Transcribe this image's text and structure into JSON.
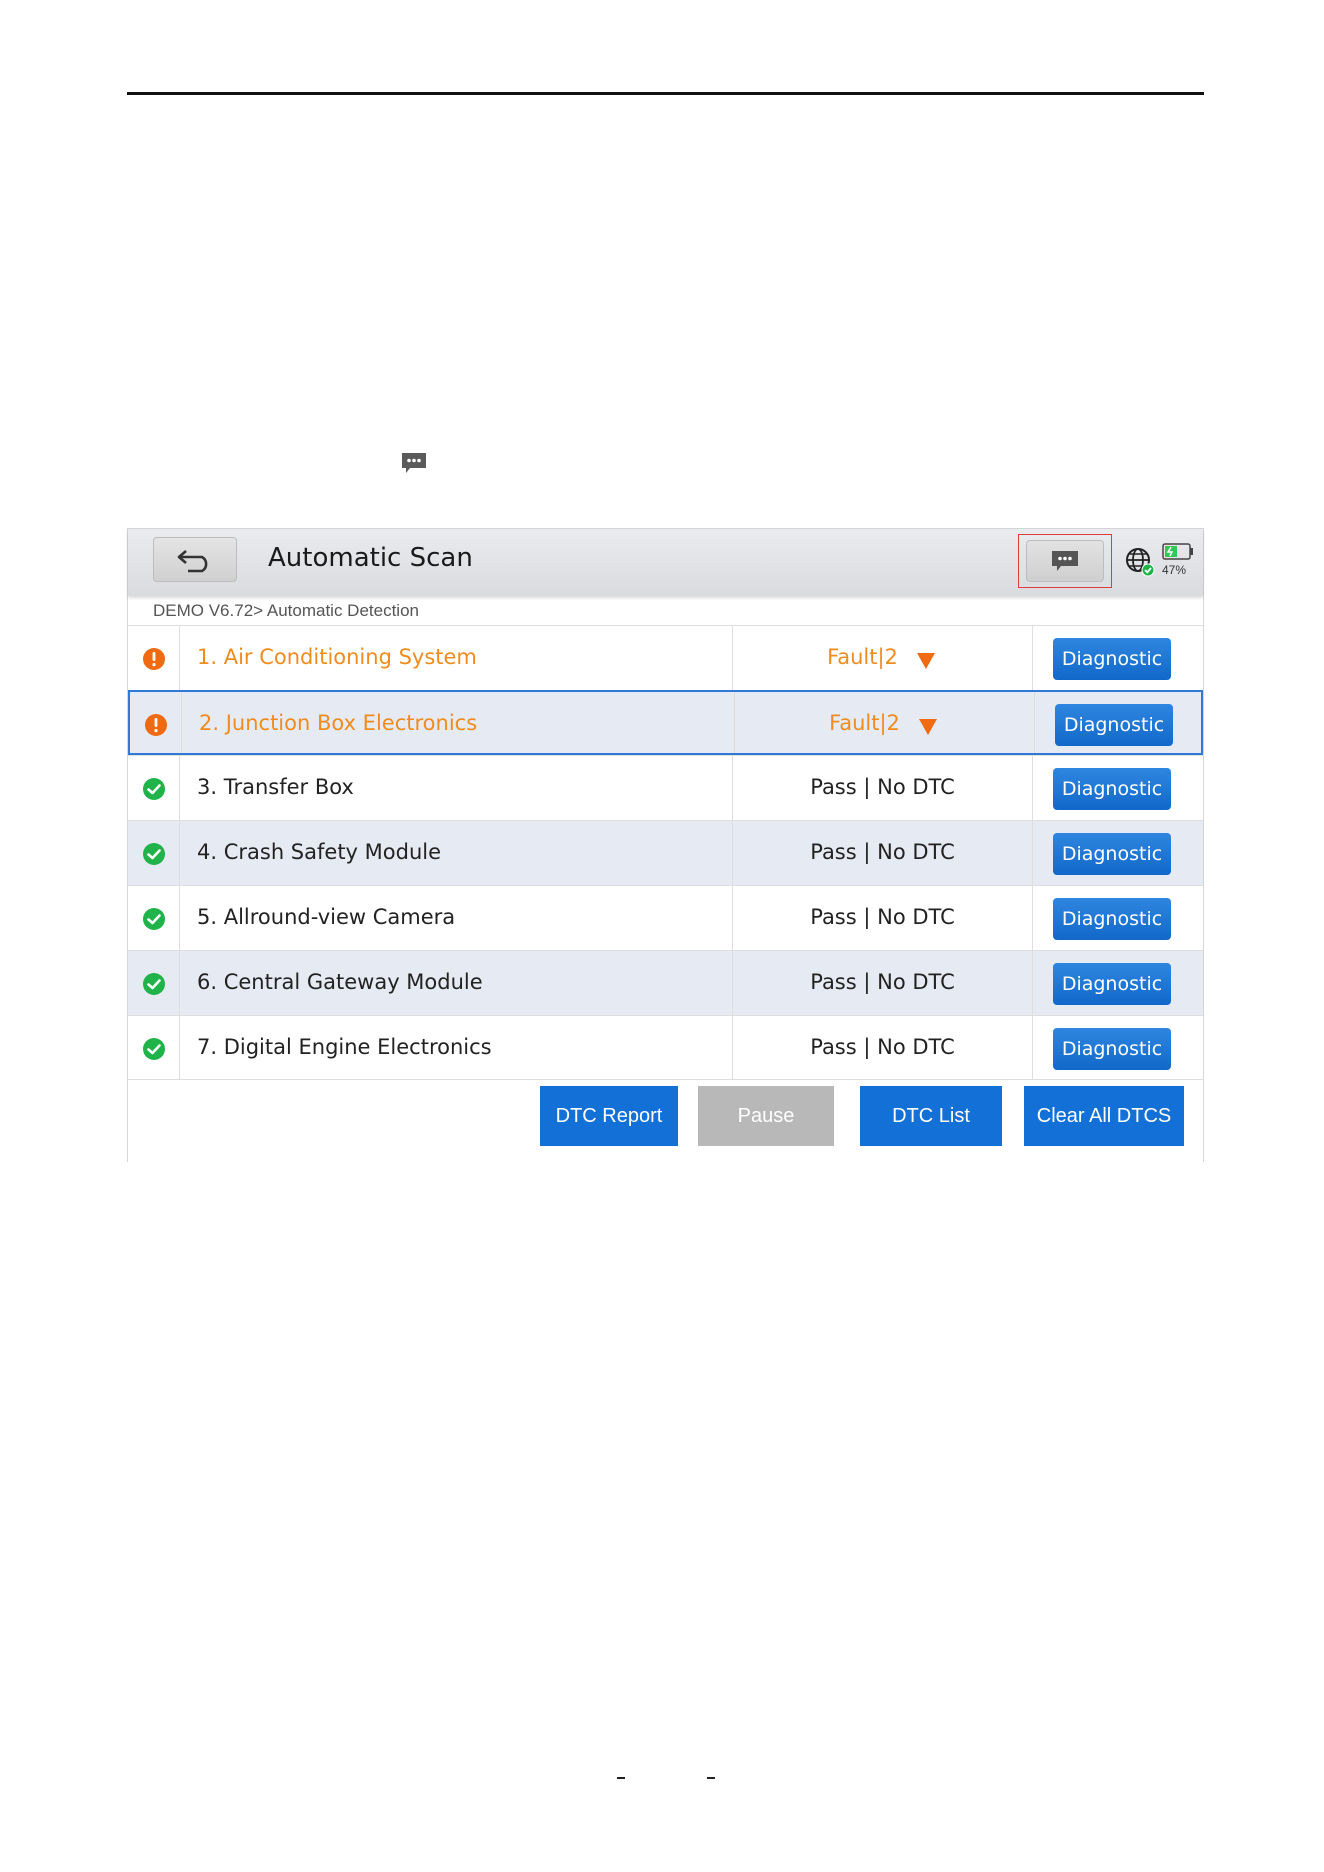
{
  "app": {
    "title": "Automatic Scan",
    "breadcrumb": "DEMO V6.72> Automatic Detection",
    "battery": "47%"
  },
  "icons": {
    "back": "back-arrow-icon",
    "message": "chat-bubble-icon",
    "globe": "globe-connected-icon",
    "battery": "battery-icon",
    "fault": "exclamation-circle-icon",
    "pass": "check-circle-icon"
  },
  "colors": {
    "fault": "#f08c1e",
    "pass": "#1fb34a",
    "button": "#1270d6",
    "disabled": "#b8b8b8",
    "highlight_border": "#e03c3c"
  },
  "systems": [
    {
      "name": "1. Air Conditioning System",
      "result": "Fault|2",
      "status": "fault",
      "button": "Diagnostic"
    },
    {
      "name": "2. Junction Box Electronics",
      "result": "Fault|2",
      "status": "fault",
      "button": "Diagnostic"
    },
    {
      "name": "3. Transfer Box",
      "result": "Pass | No DTC",
      "status": "pass",
      "button": "Diagnostic"
    },
    {
      "name": "4. Crash Safety Module",
      "result": "Pass | No DTC",
      "status": "pass",
      "button": "Diagnostic"
    },
    {
      "name": "5. Allround-view Camera",
      "result": "Pass | No DTC",
      "status": "pass",
      "button": "Diagnostic"
    },
    {
      "name": "6. Central Gateway Module",
      "result": "Pass | No DTC",
      "status": "pass",
      "button": "Diagnostic"
    },
    {
      "name": "7. Digital Engine Electronics",
      "result": "Pass | No DTC",
      "status": "pass",
      "button": "Diagnostic"
    }
  ],
  "footer": {
    "dtc_report": "DTC Report",
    "pause": "Pause",
    "dtc_list": "DTC List",
    "clear_all": "Clear All DTCS"
  }
}
